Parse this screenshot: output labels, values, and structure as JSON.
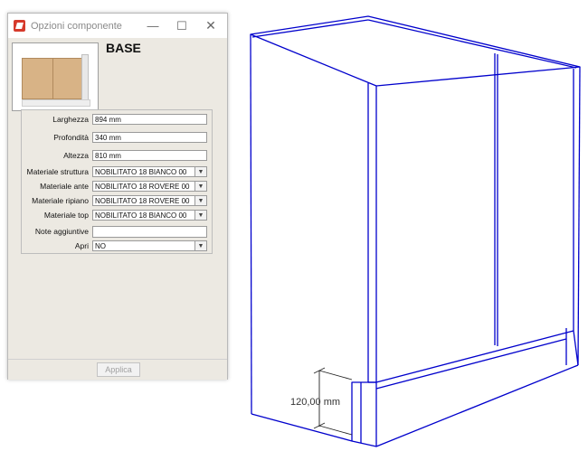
{
  "window": {
    "title": "Opzioni componente",
    "minimize_glyph": "—",
    "maximize_glyph": "☐",
    "close_glyph": "✕"
  },
  "component": {
    "name": "BASE"
  },
  "form": {
    "larghezza": {
      "label": "Larghezza",
      "value": "894 mm"
    },
    "profondita": {
      "label": "Profondità",
      "value": "340 mm"
    },
    "altezza": {
      "label": "Altezza",
      "value": "810 mm"
    },
    "materiale_struttura": {
      "label": "Materiale struttura",
      "value": "NOBILITATO 18 BIANCO 00"
    },
    "materiale_ante": {
      "label": "Materiale ante",
      "value": "NOBILITATO 18 ROVERE 00"
    },
    "materiale_ripiano": {
      "label": "Materiale ripiano",
      "value": "NOBILITATO 18 ROVERE 00"
    },
    "materiale_top": {
      "label": "Materiale top",
      "value": "NOBILITATO 18 BIANCO 00"
    },
    "note_aggiuntive": {
      "label": "Note aggiuntive",
      "value": ""
    },
    "apri": {
      "label": "Apri",
      "value": "NO"
    }
  },
  "footer": {
    "apply_label": "Applica"
  },
  "drawing": {
    "dimension_label": "120,00 mm",
    "line_color": "#0000cc"
  },
  "icons": {
    "app": "sketchup-icon",
    "dropdown": "chevron-down-icon"
  }
}
